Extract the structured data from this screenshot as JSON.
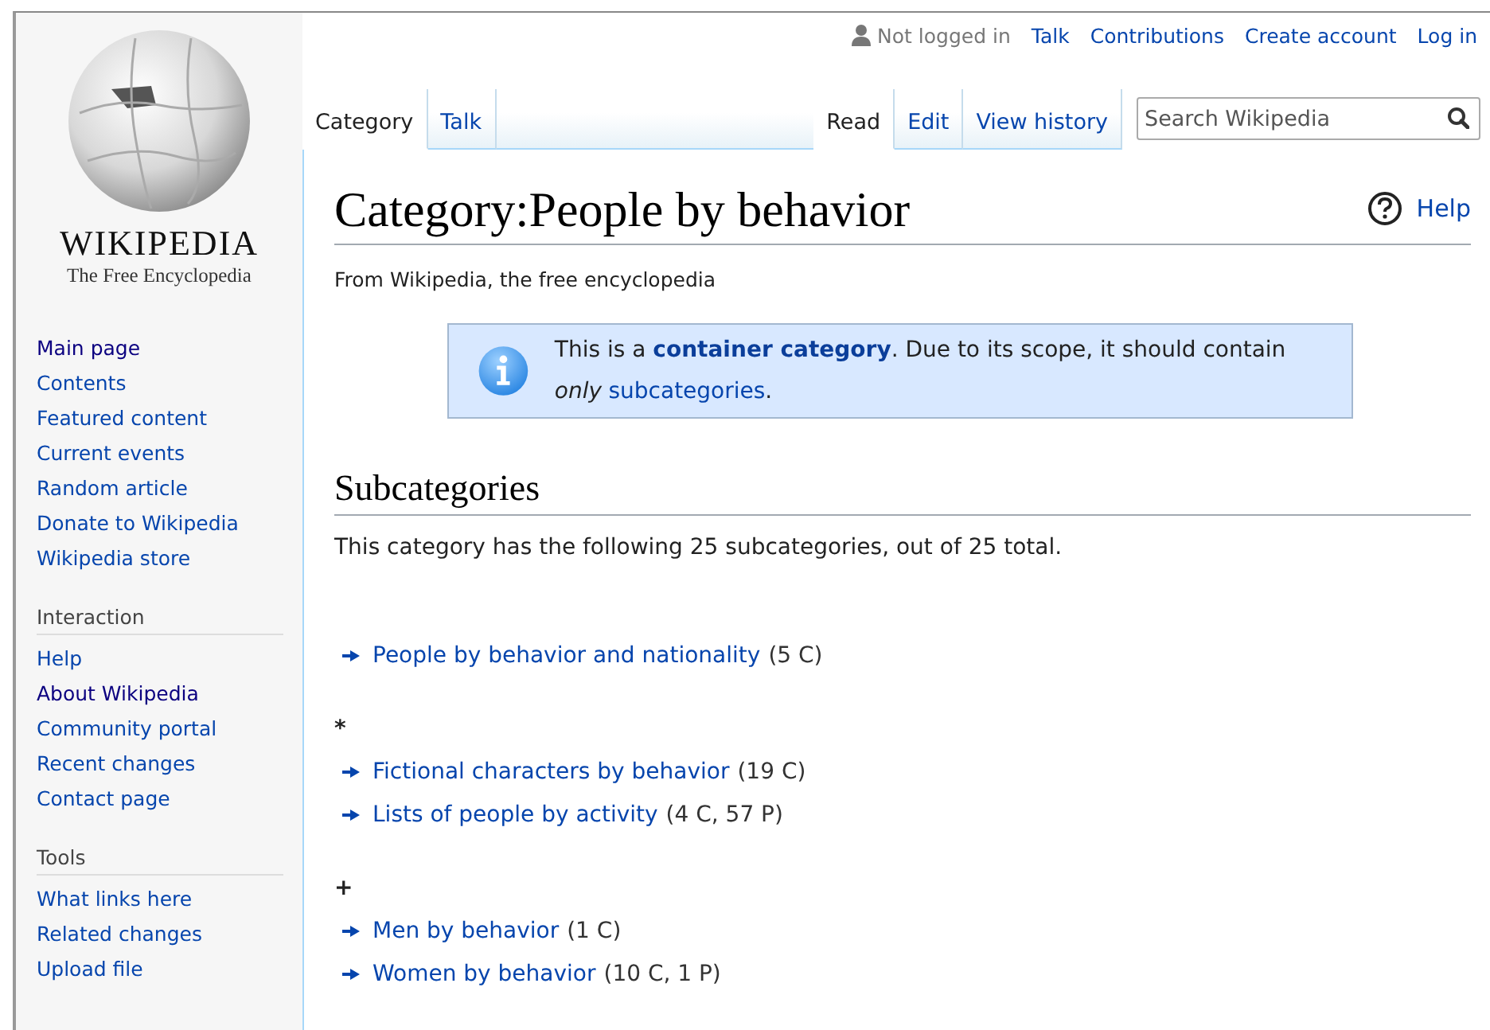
{
  "personal": {
    "status": "Not logged in",
    "links": [
      "Talk",
      "Contributions",
      "Create account",
      "Log in"
    ]
  },
  "logo": {
    "wordmark": "WIKIPEDIA",
    "tagline": "The Free Encyclopedia"
  },
  "tabs_left": [
    {
      "label": "Category",
      "selected": true
    },
    {
      "label": "Talk",
      "selected": false
    }
  ],
  "tabs_right": [
    {
      "label": "Read",
      "selected": true
    },
    {
      "label": "Edit",
      "selected": false
    },
    {
      "label": "View history",
      "selected": false
    }
  ],
  "search": {
    "placeholder": "Search Wikipedia"
  },
  "sidebar": {
    "navigation": [
      {
        "label": "Main page",
        "visited": true
      },
      {
        "label": "Contents",
        "visited": false
      },
      {
        "label": "Featured content",
        "visited": false
      },
      {
        "label": "Current events",
        "visited": false
      },
      {
        "label": "Random article",
        "visited": false
      },
      {
        "label": "Donate to Wikipedia",
        "visited": false
      },
      {
        "label": "Wikipedia store",
        "visited": false
      }
    ],
    "portals": [
      {
        "heading": "Interaction",
        "items": [
          {
            "label": "Help",
            "visited": false
          },
          {
            "label": "About Wikipedia",
            "visited": true
          },
          {
            "label": "Community portal",
            "visited": false
          },
          {
            "label": "Recent changes",
            "visited": false
          },
          {
            "label": "Contact page",
            "visited": false
          }
        ]
      },
      {
        "heading": "Tools",
        "items": [
          {
            "label": "What links here",
            "visited": false
          },
          {
            "label": "Related changes",
            "visited": false
          },
          {
            "label": "Upload file",
            "visited": false
          }
        ]
      }
    ]
  },
  "title": "Category:People by behavior",
  "help": "Help",
  "tagline": "From Wikipedia, the free encyclopedia",
  "notice": {
    "parts": [
      {
        "kind": "plain",
        "text": "This is a "
      },
      {
        "kind": "bold-link",
        "text": "container category"
      },
      {
        "kind": "plain",
        "text": ". Due to its scope, it should contain "
      },
      {
        "kind": "italic",
        "text": "only"
      },
      {
        "kind": "link",
        "text": "subcategories"
      },
      {
        "kind": "plain",
        "text": "."
      }
    ]
  },
  "section": {
    "heading": "Subcategories",
    "summary": "This category has the following 25 subcategories, out of 25 total.",
    "groups": [
      {
        "items": [
          {
            "name": "People by behavior and nationality",
            "count": "(5 C)"
          }
        ]
      },
      {
        "heading": "*",
        "items": [
          {
            "name": "Fictional characters by behavior",
            "count": "(19 C)"
          },
          {
            "name": "Lists of people by activity",
            "count": "(4 C, 57 P)"
          }
        ]
      },
      {
        "heading": "+",
        "items": [
          {
            "name": "Men by behavior",
            "count": "(1 C)"
          },
          {
            "name": "Women by behavior",
            "count": "(10 C, 1 P)"
          }
        ]
      }
    ]
  }
}
